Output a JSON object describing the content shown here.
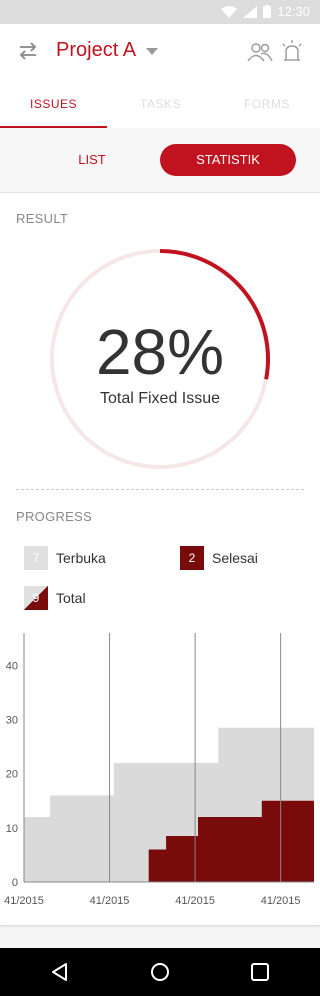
{
  "status_bar": {
    "time": "12:30"
  },
  "app_bar": {
    "project_title": "Project A"
  },
  "tabs": [
    {
      "label": "ISSUES",
      "active": true
    },
    {
      "label": "TASKS",
      "active": false
    },
    {
      "label": "FORMS",
      "active": false
    }
  ],
  "segment": {
    "list_label": "LIST",
    "statistik_label": "STATISTIK",
    "active": "STATISTIK"
  },
  "result": {
    "section_label": "RESULT",
    "percent_text": "28%",
    "percent_value": 28,
    "caption": "Total Fixed Issue"
  },
  "progress": {
    "section_label": "PROGRESS",
    "legend": {
      "terbuka": {
        "count": "7",
        "label": "Terbuka"
      },
      "selesai": {
        "count": "2",
        "label": "Selesai"
      },
      "total": {
        "count": "9",
        "label": "Total"
      }
    }
  },
  "colors": {
    "accent": "#c0131f",
    "dark_red": "#7a0b0b",
    "grey_fill": "#dadada"
  },
  "chart_data": {
    "type": "area",
    "step": true,
    "y_ticks": [
      0,
      10,
      20,
      30,
      40
    ],
    "ylim": [
      0,
      46
    ],
    "xlim": [
      0,
      1
    ],
    "x_tick_labels": [
      "41/2015",
      "41/2015",
      "41/2015",
      "41/2015"
    ],
    "series": [
      {
        "color": "#dadada",
        "points": [
          [
            0.0,
            12
          ],
          [
            0.09,
            16
          ],
          [
            0.31,
            22
          ],
          [
            0.67,
            28.5
          ],
          [
            1.0,
            28.5
          ]
        ]
      },
      {
        "color": "#7a0b0b",
        "points": [
          [
            0.43,
            6
          ],
          [
            0.49,
            8.5
          ],
          [
            0.6,
            12
          ],
          [
            0.82,
            15
          ],
          [
            1.0,
            15
          ]
        ]
      }
    ]
  }
}
